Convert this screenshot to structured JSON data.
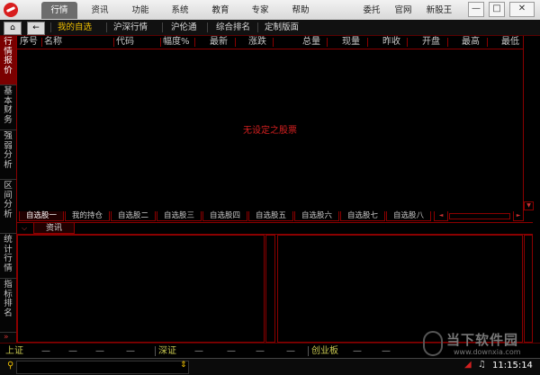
{
  "menu": {
    "items": [
      "行情",
      "资讯",
      "功能",
      "系统",
      "教育",
      "专家",
      "帮助"
    ],
    "right": [
      "委托",
      "官网",
      "新股王"
    ],
    "window_buttons": [
      "—",
      "□",
      "✕"
    ]
  },
  "toolbar": {
    "items": [
      "我的自选",
      "沪深行情",
      "沪伦通",
      "综合排名",
      "定制版面"
    ]
  },
  "left_tabs": [
    "行情报价",
    "基本财务",
    "强弱分析",
    "区间分析",
    "统计行情",
    "指标排名"
  ],
  "table": {
    "columns": [
      "序号",
      "名称",
      "代码",
      "幅度%",
      "最新",
      "涨跌",
      "总量",
      "现量",
      "昨收",
      "开盘",
      "最高",
      "最低"
    ],
    "empty_message": "无设定之股票"
  },
  "watchlist_tabs": [
    "自选股一",
    "我的持仓",
    "自选股二",
    "自选股三",
    "自选股四",
    "自选股五",
    "自选股六",
    "自选股七",
    "自选股八"
  ],
  "lower": {
    "tab": "资讯"
  },
  "index_bar": {
    "shanghai": "上证",
    "shenzhen": "深证",
    "chinext": "创业板",
    "placeholder": "—"
  },
  "status": {
    "time": "11:15:14"
  },
  "watermark": {
    "name": "当下软件园",
    "url": "www.downxia.com"
  },
  "colors": {
    "accent_red": "#8b0000",
    "text_red": "#d21f1f",
    "selected_yellow": "#f0c000"
  }
}
